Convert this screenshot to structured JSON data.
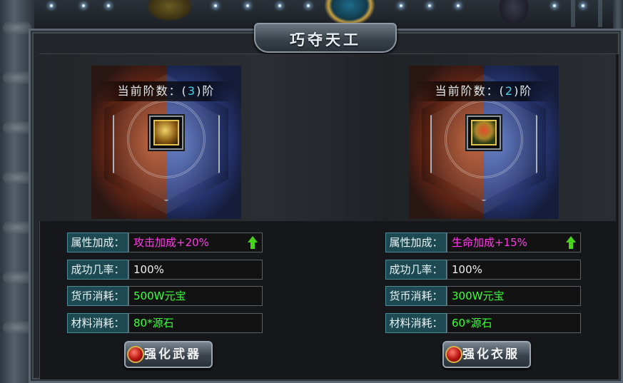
{
  "window": {
    "title": "巧夺天工"
  },
  "help": {
    "label": "?"
  },
  "panels": [
    {
      "id": "weapon",
      "tier_prefix": "当前阶数：(",
      "tier_value": "3",
      "tier_suffix": ")阶",
      "item_icon": "weapon-item-icon",
      "rows": [
        {
          "label": "属性加成：",
          "value": "攻击加成+20%",
          "color": "#ff3ae6",
          "arrow": true
        },
        {
          "label": "成功几率：",
          "value": "100%",
          "color": "#f0f0f0",
          "arrow": false
        },
        {
          "label": "货币消耗：",
          "value": "500W元宝",
          "color": "#3bff3b",
          "arrow": false
        },
        {
          "label": "材料消耗：",
          "value": "80*源石",
          "color": "#3bff3b",
          "arrow": false
        }
      ],
      "button_label": "强化武器"
    },
    {
      "id": "armor",
      "tier_prefix": "当前阶数：(",
      "tier_value": "2",
      "tier_suffix": ")阶",
      "item_icon": "armor-item-icon",
      "rows": [
        {
          "label": "属性加成：",
          "value": "生命加成+15%",
          "color": "#ff3ae6",
          "arrow": true
        },
        {
          "label": "成功几率：",
          "value": "100%",
          "color": "#f0f0f0",
          "arrow": false
        },
        {
          "label": "货币消耗：",
          "value": "300W元宝",
          "color": "#3bff3b",
          "arrow": false
        },
        {
          "label": "材料消耗：",
          "value": "60*源石",
          "color": "#3bff3b",
          "arrow": false
        }
      ],
      "button_label": "强化衣服"
    }
  ],
  "colors": {
    "accent_cyan": "#4ad0e6",
    "label_bg": "#1d4a52",
    "gold": "#b8962e"
  }
}
